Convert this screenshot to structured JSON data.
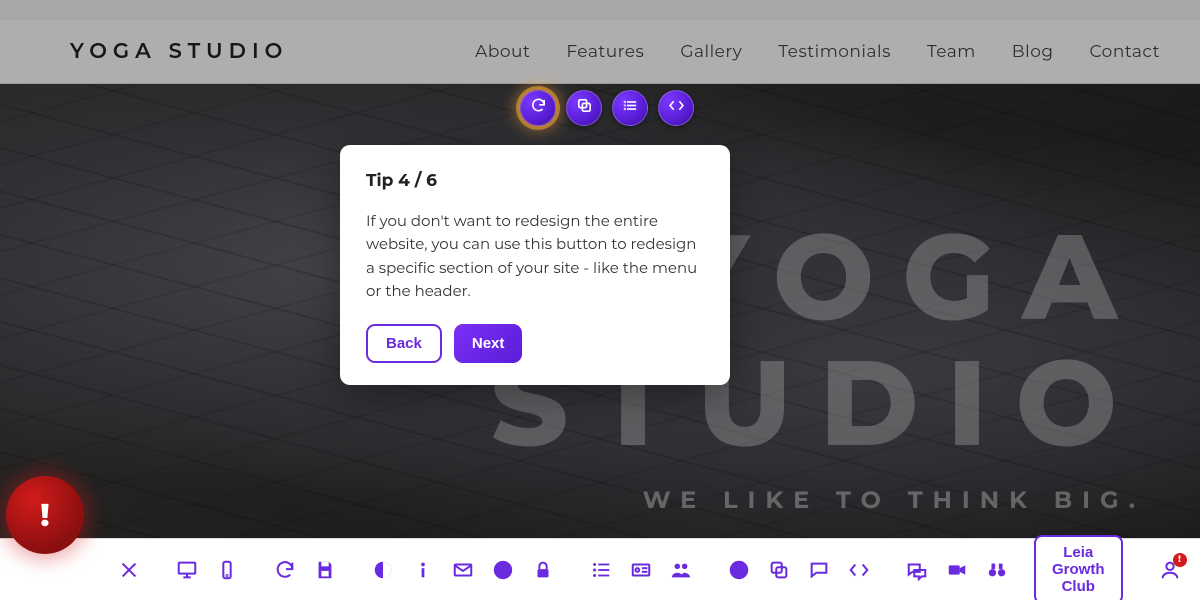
{
  "header": {
    "logo": "YOGA STUDIO",
    "nav": [
      "About",
      "Features",
      "Gallery",
      "Testimonials",
      "Team",
      "Blog",
      "Contact"
    ]
  },
  "hero": {
    "title_line1": "YOGA",
    "title_line2": "STUDIO",
    "subtitle": "WE LIKE TO THINK BIG."
  },
  "tip": {
    "title": "Tip 4 / 6",
    "body": "If you don't want to redesign the entire website, you can use this button to redesign a specific section of your site - like the menu or the header.",
    "back_label": "Back",
    "next_label": "Next"
  },
  "bottom": {
    "growth_label": "Leia Growth Club",
    "user_badge": "!"
  },
  "alert": {
    "glyph": "!"
  }
}
